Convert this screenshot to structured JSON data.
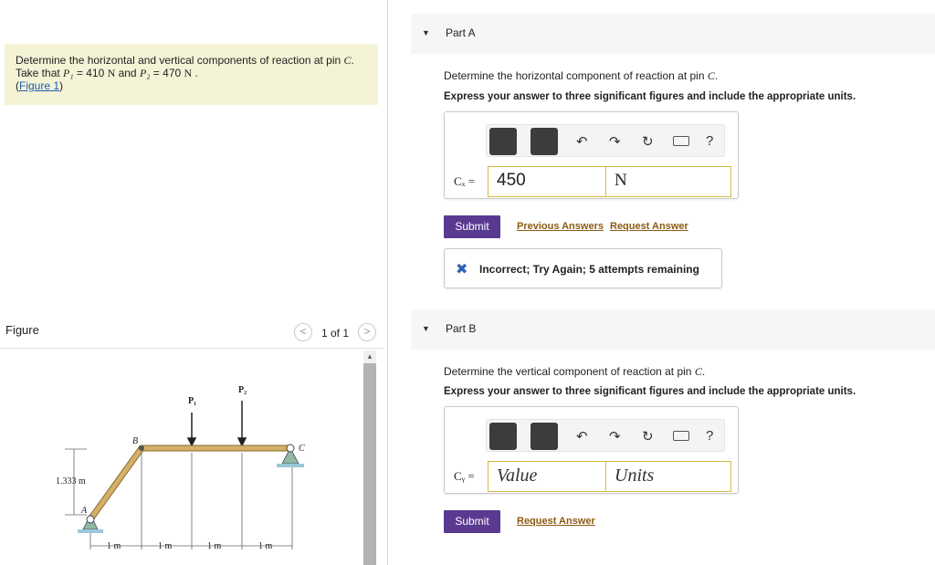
{
  "problem": {
    "line1": "Determine the horizontal and vertical components of reaction at pin ",
    "pin": "C",
    "line2_pre": "Take that ",
    "p1": "P₁",
    "p1_value": " = 410 ",
    "unit_n": "N",
    "and": " and ",
    "p2": "P₂",
    "p2_value": " = 470 ",
    "unit_n2": "N",
    "period": " .",
    "figure_link": "Figure 1"
  },
  "figure": {
    "title": "Figure",
    "prev": "<",
    "next": ">",
    "count": "1 of 1",
    "labels": {
      "p1": "P₁",
      "p2": "P₂",
      "b": "B",
      "c": "C",
      "a": "A",
      "height": "1.333 m",
      "d1": "1 m",
      "d2": "1 m",
      "d3": "1 m",
      "d4": "1 m"
    }
  },
  "partA": {
    "title": "Part A",
    "prompt": "Determine the horizontal component of reaction at pin ",
    "pin": "C",
    "instruction": "Express your answer to three significant figures and include the appropriate units.",
    "variable": "Cₓ =",
    "value": "450",
    "unit": "N",
    "submit": "Submit",
    "previous_answers": "Previous Answers",
    "request_answer": "Request Answer",
    "feedback": "Incorrect; Try Again; 5 attempts remaining"
  },
  "partB": {
    "title": "Part B",
    "prompt": "Determine the vertical component of reaction at pin ",
    "pin": "C",
    "instruction": "Express your answer to three significant figures and include the appropriate units.",
    "variable": "Cᵧ =",
    "value_placeholder": "Value",
    "unit_placeholder": "Units",
    "submit": "Submit",
    "request_answer": "Request Answer"
  },
  "toolbar": {
    "help": "?"
  },
  "colors": {
    "submit": "#5a3a91",
    "problem_bg": "#f5f3d6",
    "field_border": "#d5b948",
    "link": "#8c5a12"
  }
}
